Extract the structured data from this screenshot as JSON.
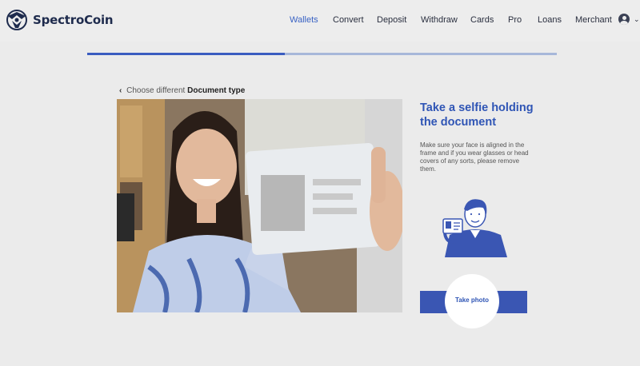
{
  "brand": {
    "name": "SpectroCoin"
  },
  "nav": {
    "items": [
      {
        "label": "Wallets",
        "active": true
      },
      {
        "label": "Convert"
      },
      {
        "label": "Deposit"
      },
      {
        "label": "Withdraw"
      },
      {
        "label": "Cards"
      },
      {
        "label": "Pro"
      },
      {
        "label": "Loans"
      },
      {
        "label": "Merchant"
      }
    ],
    "user_icon": "user-avatar-icon",
    "user_menu_icon": "chevron-down-icon"
  },
  "progress": {
    "fraction": 0.42
  },
  "back_link": {
    "icon": "chevron-left-icon",
    "prefix": "Choose different",
    "strong": "Document type"
  },
  "main": {
    "heading": "Take a selfie holding the document",
    "description": "Make sure your face is aligned in the frame and if you wear glasses or head covers of any sorts, please remove them.",
    "button_label": "Take photo"
  },
  "colors": {
    "accent": "#3a56b3",
    "heading": "#2f55b5",
    "brand": "#1e2b4d"
  }
}
